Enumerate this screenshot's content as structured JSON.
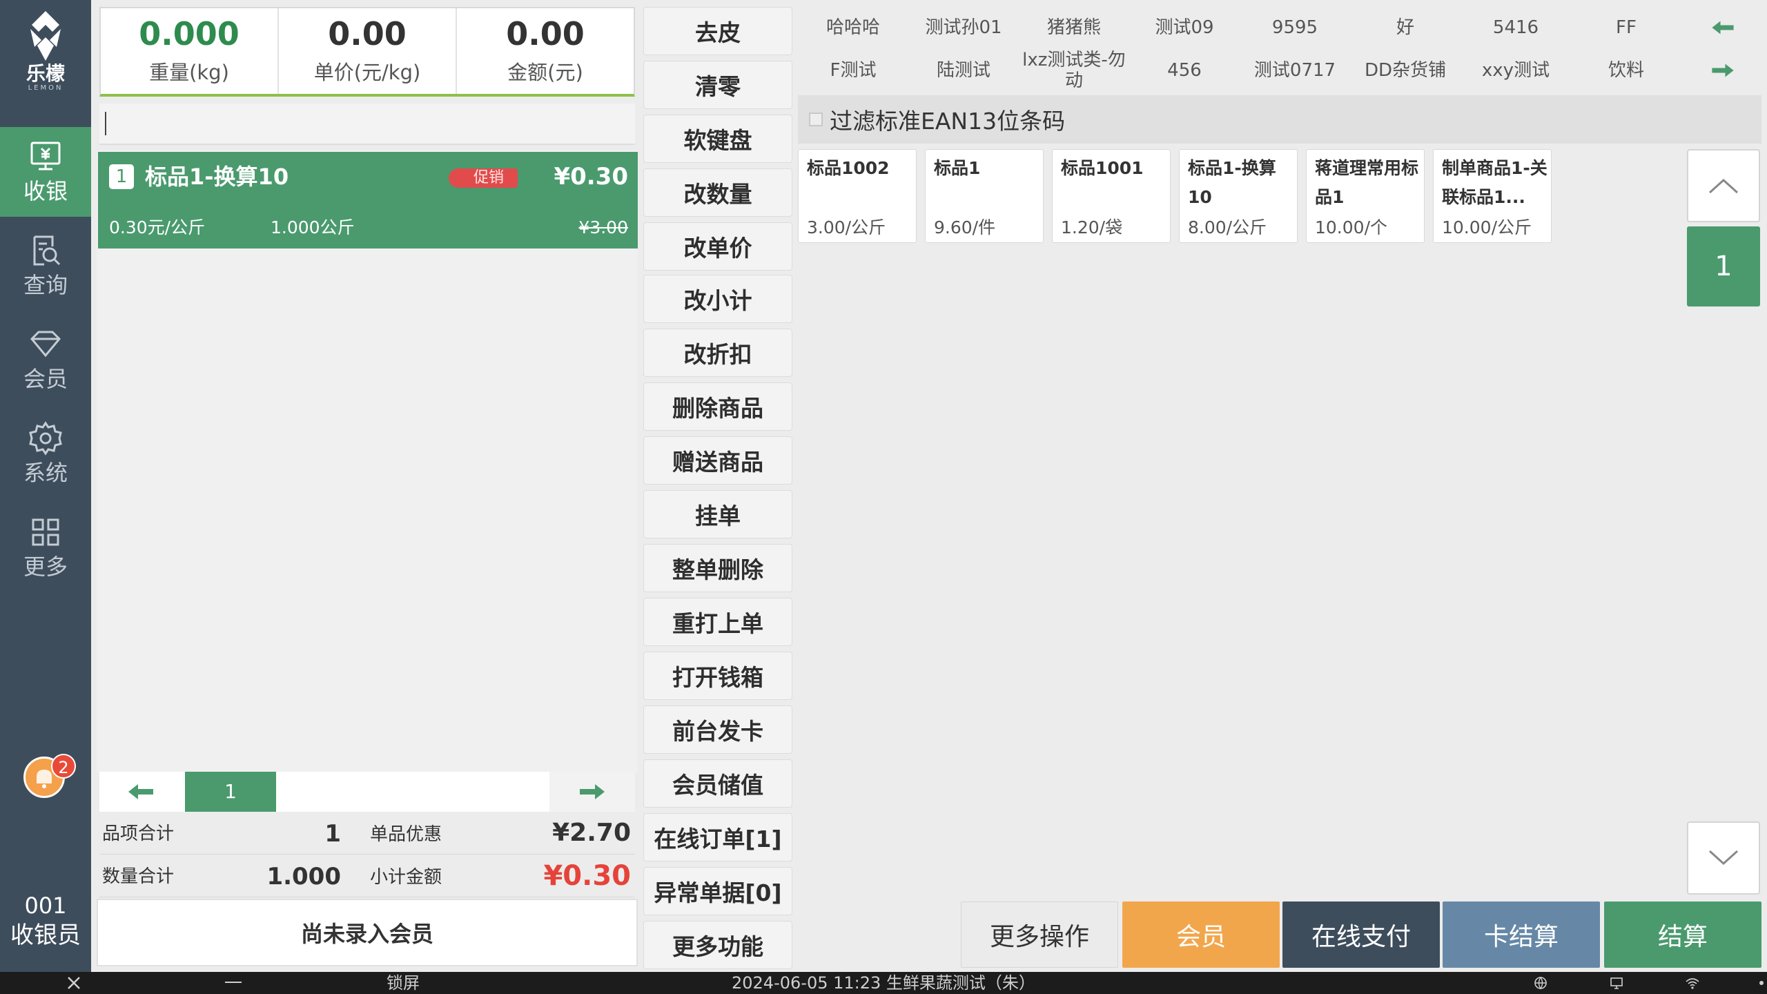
{
  "brand": {
    "name_cn": "乐檬",
    "name_en": "LEMON"
  },
  "nav": [
    {
      "label": "收银",
      "icon": "cash-register-icon",
      "active": true
    },
    {
      "label": "查询",
      "icon": "query-icon",
      "active": false
    },
    {
      "label": "会员",
      "icon": "member-diamond-icon",
      "active": false
    },
    {
      "label": "系统",
      "icon": "gear-icon",
      "active": false
    },
    {
      "label": "更多",
      "icon": "grid-icon",
      "active": false
    }
  ],
  "notifications": {
    "count": "2"
  },
  "cashier": {
    "number": "001",
    "label": "收银员"
  },
  "scale": {
    "weight": {
      "value": "0.000",
      "label": "重量(kg)"
    },
    "unit_price": {
      "value": "0.00",
      "label": "单价(元/kg)"
    },
    "amount": {
      "value": "0.00",
      "label": "金额(元)"
    }
  },
  "barcode": {
    "value": "",
    "placeholder": ""
  },
  "cart": {
    "items": [
      {
        "index": "1",
        "name": "标品1-换算10",
        "promo_tag": "促销",
        "amount": "¥0.30",
        "unit_price": "0.30元/公斤",
        "quantity": "1.000公斤",
        "original_amount": "¥3.00"
      }
    ]
  },
  "pager": {
    "current": "1"
  },
  "totals": {
    "items_label": "品项合计",
    "items_count": "1",
    "discount_label": "单品优惠",
    "discount_amount": "¥2.70",
    "qty_label": "数量合计",
    "qty_total": "1.000",
    "subtotal_label": "小计金额",
    "subtotal_amount": "¥0.30"
  },
  "member_status": "尚未录入会员",
  "functions": [
    "去皮",
    "清零",
    "软键盘",
    "改数量",
    "改单价",
    "改小计",
    "改折扣",
    "删除商品",
    "赠送商品",
    "挂单",
    "整单删除",
    "重打上单",
    "打开钱箱",
    "前台发卡",
    "会员储值",
    "在线订单[1]",
    "异常单据[0]",
    "更多功能"
  ],
  "categories": {
    "row1": [
      "哈哈哈",
      "测试孙01",
      "猪猪熊",
      "测试09",
      "9595",
      "好",
      "5416",
      "FF"
    ],
    "row2": [
      "F测试",
      "陆测试",
      "lxz测试类-勿动",
      "456",
      "测试0717",
      "DD杂货铺",
      "xxy测试",
      "饮料"
    ]
  },
  "filter": {
    "label": "过滤标准EAN13位条码",
    "checked": false
  },
  "products": [
    {
      "name": "标品1002",
      "price": "3.00/公斤"
    },
    {
      "name": "标品1",
      "price": "9.60/件"
    },
    {
      "name": "标品1001",
      "price": "1.20/袋"
    },
    {
      "name": "标品1-换算10",
      "price": "8.00/公斤"
    },
    {
      "name": "蒋道理常用标品1",
      "price": "10.00/个"
    },
    {
      "name": "制单商品1-关联标品1...",
      "price": "10.00/公斤"
    }
  ],
  "product_page": "1",
  "actions": {
    "more": "更多操作",
    "member": "会员",
    "online_pay": "在线支付",
    "card_settle": "卡结算",
    "checkout": "结算"
  },
  "statusbar": {
    "lock": "锁屏",
    "info": "2024-06-05 11:23 生鲜果蔬测试（朱）"
  },
  "colors": {
    "sidebar": "#3e4d5c",
    "accent_green": "#4a9a6e",
    "member_orange": "#f2a64c",
    "card_blue": "#6688a6",
    "price_red": "#e5433a"
  }
}
